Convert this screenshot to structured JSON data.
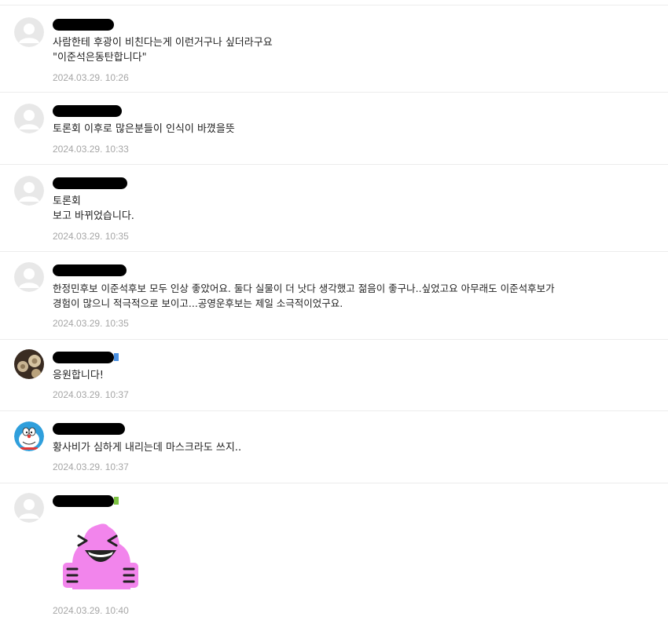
{
  "colors": {
    "divider": "#ececec",
    "date_text": "#a6a6a6",
    "body_text": "#222222",
    "default_avatar_bg": "#e8e8e8",
    "default_avatar_fg": "#ffffff",
    "sticker_pink": "#f285ec"
  },
  "comments": [
    {
      "avatar": "default-avatar",
      "lines": [
        "사람한테 후광이 비친다는게 이런거구나 싶더라구요",
        "\"이준석은동탄합니다\""
      ],
      "date": "2024.03.29. 10:26"
    },
    {
      "avatar": "default-avatar",
      "lines": [
        "토론회 이후로 많은분들이 인식이 바꼈을뜻"
      ],
      "date": "2024.03.29. 10:33"
    },
    {
      "avatar": "default-avatar",
      "lines": [
        "토론회",
        "보고 바뀌었습니다."
      ],
      "date": "2024.03.29. 10:35"
    },
    {
      "avatar": "default-avatar",
      "lines": [
        "한정민후보 이준석후보 모두 인상 좋았어요. 둘다 실물이 더 낫다 생각했고 젊음이 좋구나..싶었고요 아무래도 이준석후보가",
        "경험이 많으니 적극적으로 보이고...공영운후보는 제일 소극적이었구요."
      ],
      "date": "2024.03.29. 10:35"
    },
    {
      "avatar": "photo-avatar",
      "lines": [
        "응원합니다!"
      ],
      "date": "2024.03.29. 10:37"
    },
    {
      "avatar": "cartoon-avatar",
      "lines": [
        "황사비가 심하게 내리는데 마스크라도 쓰지.."
      ],
      "date": "2024.03.29. 10:37"
    },
    {
      "avatar": "default-avatar",
      "sticker": "laughing-pink-sticker",
      "date": "2024.03.29. 10:40"
    }
  ]
}
